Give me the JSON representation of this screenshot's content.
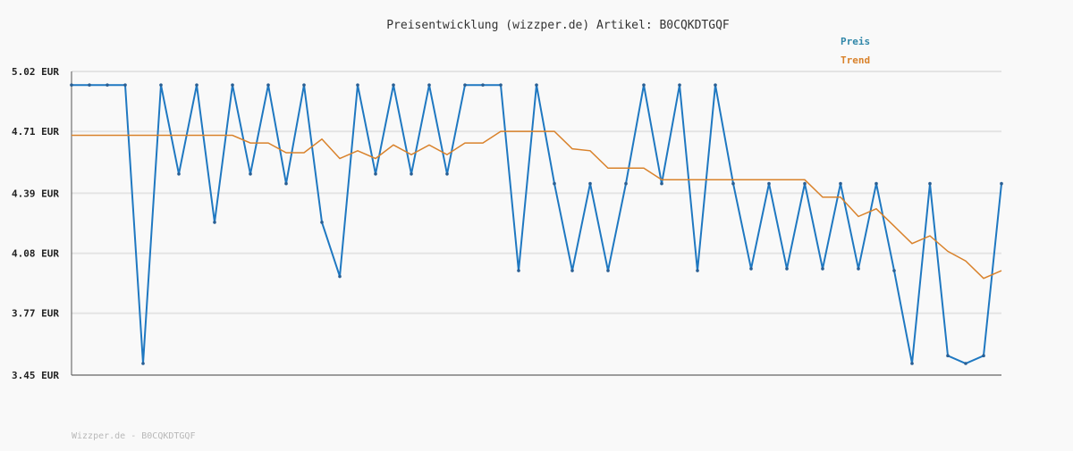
{
  "chart_data": {
    "type": "line",
    "title": "Preisentwicklung (wizzper.de) Artikel: B0CQKDTGQF",
    "ylim": [
      3.45,
      5.02
    ],
    "y_ticks": [
      "3.45 EUR",
      "3.77 EUR",
      "4.08 EUR",
      "4.39 EUR",
      "4.71 EUR",
      "5.02 EUR"
    ],
    "y_tick_values": [
      3.45,
      3.77,
      4.08,
      4.39,
      4.71,
      5.02
    ],
    "grid": true,
    "legend_placement": "top-right",
    "series": [
      {
        "name": "Preis",
        "color": "#1f78c1",
        "values": [
          4.95,
          4.95,
          4.95,
          4.95,
          3.51,
          4.95,
          4.49,
          4.95,
          4.24,
          4.95,
          4.49,
          4.95,
          4.44,
          4.95,
          4.24,
          3.96,
          4.95,
          4.49,
          4.95,
          4.49,
          4.95,
          4.49,
          4.95,
          4.95,
          4.95,
          3.99,
          4.95,
          4.44,
          3.99,
          4.44,
          3.99,
          4.44,
          4.95,
          4.44,
          4.95,
          3.99,
          4.95,
          4.44,
          4.0,
          4.44,
          4.0,
          4.44,
          4.0,
          4.44,
          4.0,
          4.44,
          3.99,
          3.51,
          4.44,
          3.55,
          3.51,
          3.55,
          4.44
        ]
      },
      {
        "name": "Trend",
        "color": "#d9822b",
        "values": [
          4.69,
          4.69,
          4.69,
          4.69,
          4.69,
          4.69,
          4.69,
          4.69,
          4.69,
          4.69,
          4.65,
          4.65,
          4.6,
          4.6,
          4.67,
          4.57,
          4.61,
          4.57,
          4.64,
          4.59,
          4.64,
          4.59,
          4.65,
          4.65,
          4.71,
          4.71,
          4.71,
          4.71,
          4.62,
          4.61,
          4.52,
          4.52,
          4.52,
          4.46,
          4.46,
          4.46,
          4.46,
          4.46,
          4.46,
          4.46,
          4.46,
          4.46,
          4.37,
          4.37,
          4.27,
          4.31,
          4.22,
          4.13,
          4.17,
          4.09,
          4.04,
          3.95,
          3.99
        ]
      }
    ]
  },
  "footer": {
    "text": "Wizzper.de - B0CQKDTGQF"
  }
}
